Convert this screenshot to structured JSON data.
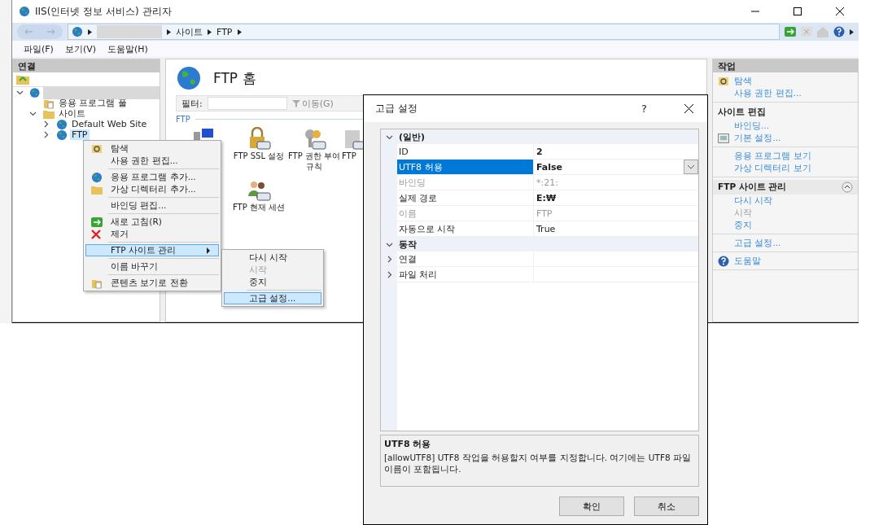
{
  "window": {
    "title": "IIS(인터넷 정보 서비스) 관리자"
  },
  "address": {
    "segments": [
      "사이트",
      "FTP"
    ]
  },
  "menu": [
    "파일(F)",
    "보기(V)",
    "도움말(H)"
  ],
  "connections": {
    "title": "연결",
    "tree": [
      {
        "expanded": true,
        "children": [
          {
            "label": "응용 프로그램 풀",
            "selected": false
          },
          {
            "label": "사이트",
            "expanded": true,
            "selected": false,
            "children": [
              {
                "label": "Default Web Site",
                "expanded": false,
                "selected": false
              },
              {
                "label": "FTP",
                "expanded": false,
                "selected": true
              }
            ]
          }
        ]
      }
    ]
  },
  "center": {
    "title": "FTP 홈",
    "filter_label": "필터:",
    "go_button": "이동(G)",
    "group": "FTP",
    "features": [
      {
        "kind": "icon"
      },
      {
        "kind": "labeled",
        "label": "FTP SSL 설정"
      },
      {
        "kind": "labeled",
        "label": "FTP 권한 부여 규칙"
      },
      {
        "kind": "labeled",
        "label": "FTP"
      },
      {
        "kind": "labeled",
        "label": "FTP 현재 세션"
      }
    ]
  },
  "actions": {
    "title": "작업",
    "groups": [
      {
        "items": [
          {
            "label": "탐색",
            "disabled": false
          },
          {
            "label": "사용 권한 편집...",
            "disabled": false
          }
        ]
      },
      {
        "heading": "사이트 편집",
        "items": [
          {
            "label": "바인딩...",
            "disabled": false
          },
          {
            "label": "기본 설정...",
            "disabled": false
          }
        ]
      },
      {
        "items": [
          {
            "label": "응용 프로그램 보기",
            "disabled": false
          },
          {
            "label": "가상 디렉터리 보기",
            "disabled": false
          }
        ]
      },
      {
        "heading": "FTP 사이트 관리",
        "kind": "band",
        "items": [
          {
            "label": "다시 시작",
            "disabled": false
          },
          {
            "label": "시작",
            "disabled": true
          },
          {
            "label": "중지",
            "disabled": false
          }
        ]
      },
      {
        "items": [
          {
            "label": "고급 설정...",
            "disabled": false
          }
        ]
      },
      {
        "items": [
          {
            "label": "도움말",
            "disabled": false
          }
        ]
      }
    ]
  },
  "context_menu": {
    "items": [
      {
        "kind": "item",
        "label": "탐색",
        "selected": false
      },
      {
        "kind": "item",
        "label": "사용 권한 편집...",
        "selected": false
      },
      {
        "kind": "separator"
      },
      {
        "kind": "item",
        "label": "응용 프로그램 추가...",
        "selected": false
      },
      {
        "kind": "item",
        "label": "가상 디렉터리 추가...",
        "selected": false
      },
      {
        "kind": "separator"
      },
      {
        "kind": "item",
        "label": "바인딩 편집...",
        "selected": false
      },
      {
        "kind": "separator"
      },
      {
        "kind": "item",
        "label": "새로 고침(R)",
        "selected": false
      },
      {
        "kind": "item",
        "label": "제거",
        "selected": false
      },
      {
        "kind": "separator"
      },
      {
        "kind": "submenu",
        "label": "FTP 사이트 관리",
        "selected": true
      },
      {
        "kind": "separator"
      },
      {
        "kind": "item",
        "label": "이름 바꾸기",
        "selected": false
      },
      {
        "kind": "separator"
      },
      {
        "kind": "item",
        "label": "콘텐츠 보기로 전환",
        "selected": false
      }
    ]
  },
  "submenu": {
    "items": [
      {
        "kind": "item",
        "label": "다시 시작",
        "disabled": false,
        "selected": false
      },
      {
        "kind": "item",
        "label": "시작",
        "disabled": true,
        "selected": false
      },
      {
        "kind": "item",
        "label": "중지",
        "disabled": false,
        "selected": false
      },
      {
        "kind": "separator"
      },
      {
        "kind": "item",
        "label": "고급 설정...",
        "disabled": false,
        "selected": true
      }
    ]
  },
  "dialog": {
    "title": "고급 설정",
    "help": "?",
    "categories": [
      {
        "label": "(일반)",
        "expanded": true,
        "rows": [
          {
            "name": "ID",
            "value": "2",
            "bold": true,
            "disabled": false,
            "selected": false
          },
          {
            "name": "UTF8 허용",
            "value": "False",
            "bold": true,
            "disabled": false,
            "selected": true
          },
          {
            "name": "바인딩",
            "value": "*:21:",
            "bold": false,
            "disabled": true,
            "selected": false
          },
          {
            "name": "실제 경로",
            "value": "E:₩",
            "bold": true,
            "disabled": false,
            "selected": false
          },
          {
            "name": "이름",
            "value": "FTP",
            "bold": false,
            "disabled": true,
            "selected": false
          },
          {
            "name": "자동으로 시작",
            "value": "True",
            "bold": false,
            "disabled": false,
            "selected": false
          }
        ]
      },
      {
        "label": "동작",
        "expanded": true,
        "rows": [
          {
            "name": "연결",
            "expanded": false,
            "selected": false
          },
          {
            "name": "파일 처리",
            "expanded": false,
            "selected": false
          }
        ]
      }
    ],
    "description": {
      "title": "UTF8 허용",
      "text": "[allowUTF8] UTF8 작업을 허용할지 여부를 지정합니다. 여기에는 UTF8 파일 이름이 포함됩니다."
    },
    "buttons": [
      "확인",
      "취소"
    ]
  }
}
